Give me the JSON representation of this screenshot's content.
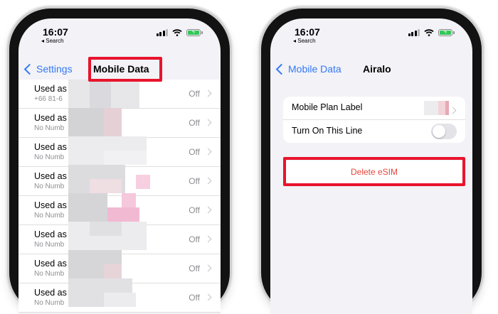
{
  "left_screen": {
    "status": {
      "time": "16:07",
      "back_app": "◂ Search"
    },
    "nav": {
      "back_label": "Settings",
      "title": "Mobile Data"
    },
    "rows": [
      {
        "title": "Used as",
        "subtitle": "+66 81-6",
        "value": "Off"
      },
      {
        "title": "Used as",
        "subtitle": "No Numb",
        "value": "Off"
      },
      {
        "title": "Used as",
        "subtitle": "No Numb",
        "value": "Off"
      },
      {
        "title": "Used as",
        "subtitle": "No Numb",
        "value": "Off"
      },
      {
        "title": "Used as",
        "subtitle": "No Numb",
        "value": "Off"
      },
      {
        "title": "Used as",
        "subtitle": "No Numb",
        "value": "Off"
      },
      {
        "title": "Used as",
        "subtitle": "No Numb",
        "value": "Off"
      },
      {
        "title": "Used as",
        "subtitle": "No Numb",
        "value": "Off"
      }
    ]
  },
  "right_screen": {
    "status": {
      "time": "16:07",
      "back_app": "◂ Search"
    },
    "nav": {
      "back_label": "Mobile Data",
      "title": "Airalo"
    },
    "settings": {
      "mobile_plan_label": "Mobile Plan Label",
      "turn_on_line_label": "Turn On This Line",
      "turn_on_line_enabled": false
    },
    "delete_label": "Delete eSIM"
  },
  "colors": {
    "ios_blue": "#3478f6",
    "highlight_red": "#e8142c",
    "delete_red": "#e3463c"
  }
}
